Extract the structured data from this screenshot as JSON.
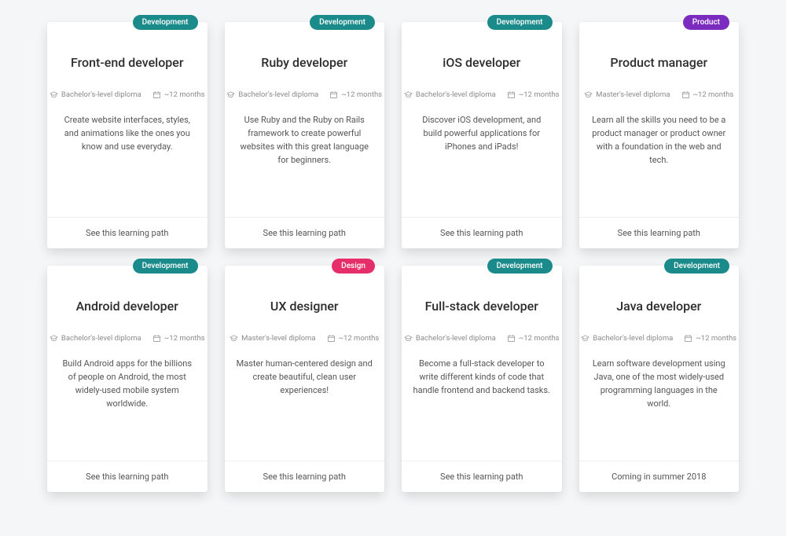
{
  "tag_colors": {
    "Development": "development",
    "Product": "product",
    "Design": "design"
  },
  "cards": [
    {
      "tag": "Development",
      "title": "Front-end developer",
      "diploma": "Bachelor's-level diploma",
      "duration": "~12 months",
      "desc": "Create website interfaces, styles, and animations like the ones you know and use everyday.",
      "cta": "See this learning path"
    },
    {
      "tag": "Development",
      "title": "Ruby developer",
      "diploma": "Bachelor's-level diploma",
      "duration": "~12 months",
      "desc": "Use Ruby and the Ruby on Rails framework to create powerful websites with this great language for beginners.",
      "cta": "See this learning path"
    },
    {
      "tag": "Development",
      "title": "iOS developer",
      "diploma": "Bachelor's-level diploma",
      "duration": "~12 months",
      "desc": "Discover iOS development, and build powerful applications for iPhones and iPads!",
      "cta": "See this learning path"
    },
    {
      "tag": "Product",
      "title": "Product manager",
      "diploma": "Master's-level diploma",
      "duration": "~12 months",
      "desc": "Learn all the skills you need to be a product manager or product owner with a foundation in the web and tech.",
      "cta": "See this learning path"
    },
    {
      "tag": "Development",
      "title": "Android developer",
      "diploma": "Bachelor's-level diploma",
      "duration": "~12 months",
      "desc": "Build Android apps for the billions of people on Android, the most widely-used mobile system worldwide.",
      "cta": "See this learning path"
    },
    {
      "tag": "Design",
      "title": "UX designer",
      "diploma": "Master's-level diploma",
      "duration": "~12 months",
      "desc": "Master human-centered design and create beautiful, clean user experiences!",
      "cta": "See this learning path"
    },
    {
      "tag": "Development",
      "title": "Full-stack developer",
      "diploma": "Bachelor's-level diploma",
      "duration": "~12 months",
      "desc": "Become a full-stack developer to write different kinds of code that handle frontend and backend tasks.",
      "cta": "See this learning path"
    },
    {
      "tag": "Development",
      "title": "Java developer",
      "diploma": "Bachelor's-level diploma",
      "duration": "~12 months",
      "desc": "Learn software development using Java, one of the most widely-used programming languages in the world.",
      "cta": "Coming in summer 2018"
    }
  ]
}
